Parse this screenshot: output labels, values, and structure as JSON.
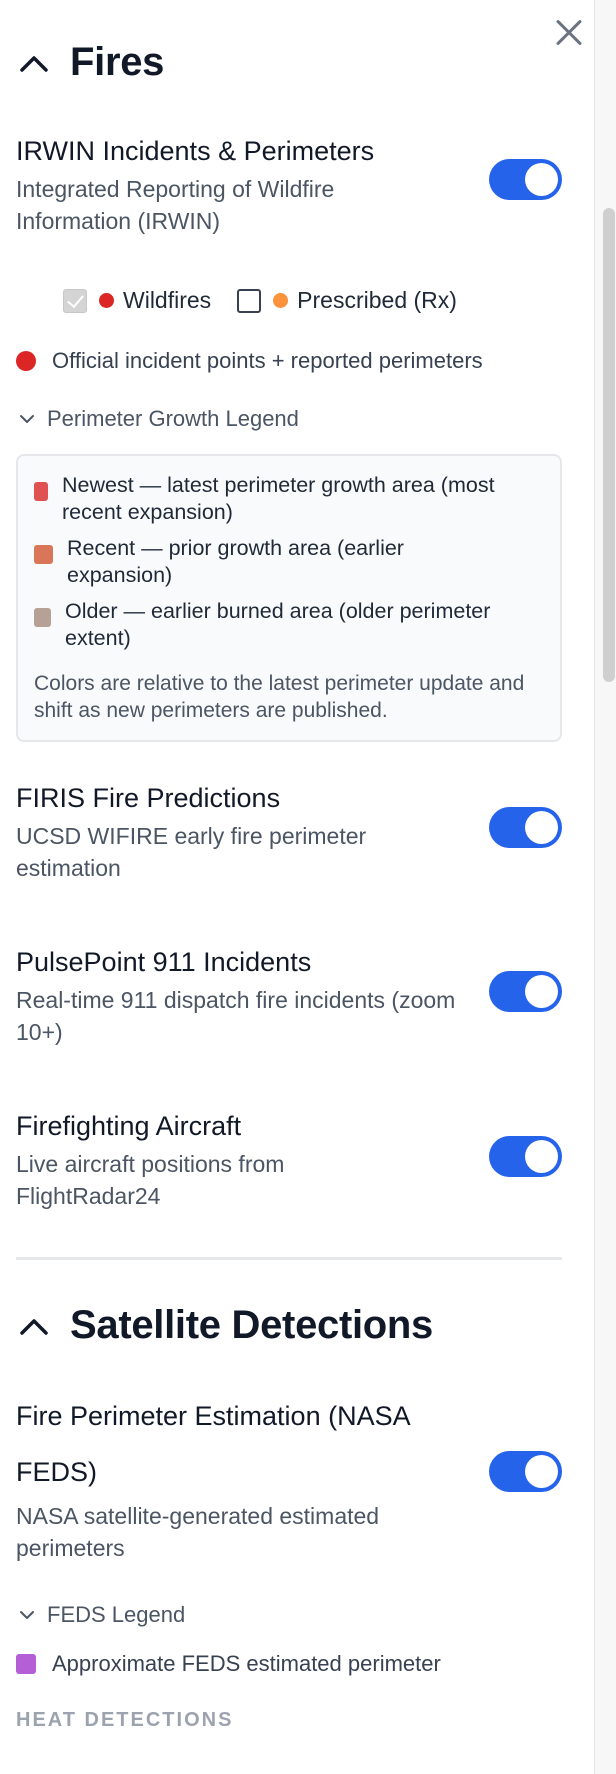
{
  "close": {
    "icon": "close-icon"
  },
  "fires": {
    "title": "Fires",
    "irwin": {
      "title": "IRWIN Incidents & Perimeters",
      "description": "Integrated Reporting of Wildfire Information (IRWIN)",
      "enabled": true,
      "filters": [
        {
          "label": "Wildfires",
          "checked": true,
          "color": "#dc2626"
        },
        {
          "label": "Prescribed (Rx)",
          "checked": false,
          "color": "#fb923c"
        }
      ],
      "info": "Official incident points + reported perimeters",
      "info_color": "#dc2626",
      "legend_toggle": "Perimeter Growth Legend",
      "legend": [
        {
          "label": "Newest — latest perimeter growth area (most recent expansion)",
          "color": "#e05252"
        },
        {
          "label": "Recent — prior growth area (earlier expansion)",
          "color": "#d9765a"
        },
        {
          "label": "Older — earlier burned area (older perimeter extent)",
          "color": "#b5a195"
        }
      ],
      "legend_note": "Colors are relative to the latest perimeter update and shift as new perimeters are published."
    },
    "firis": {
      "title": "FIRIS Fire Predictions",
      "description": "UCSD WIFIRE early fire perimeter estimation",
      "enabled": true
    },
    "pulsepoint": {
      "title": "PulsePoint 911 Incidents",
      "description": "Real-time 911 dispatch fire incidents (zoom 10+)",
      "enabled": true
    },
    "aircraft": {
      "title": "Firefighting Aircraft",
      "description": "Live aircraft positions from FlightRadar24",
      "enabled": true
    }
  },
  "satellite": {
    "title": "Satellite Detections",
    "feds": {
      "title": "Fire Perimeter Estimation (NASA FEDS)",
      "description": "NASA satellite-generated estimated perimeters",
      "enabled": true,
      "legend_toggle": "FEDS Legend",
      "legend_item": "Approximate FEDS estimated perimeter",
      "legend_color": "#b45fd6"
    },
    "heat_heading": "HEAT DETECTIONS"
  },
  "colors": {
    "toggle_on": "#2563eb",
    "accent": "#2563eb"
  }
}
